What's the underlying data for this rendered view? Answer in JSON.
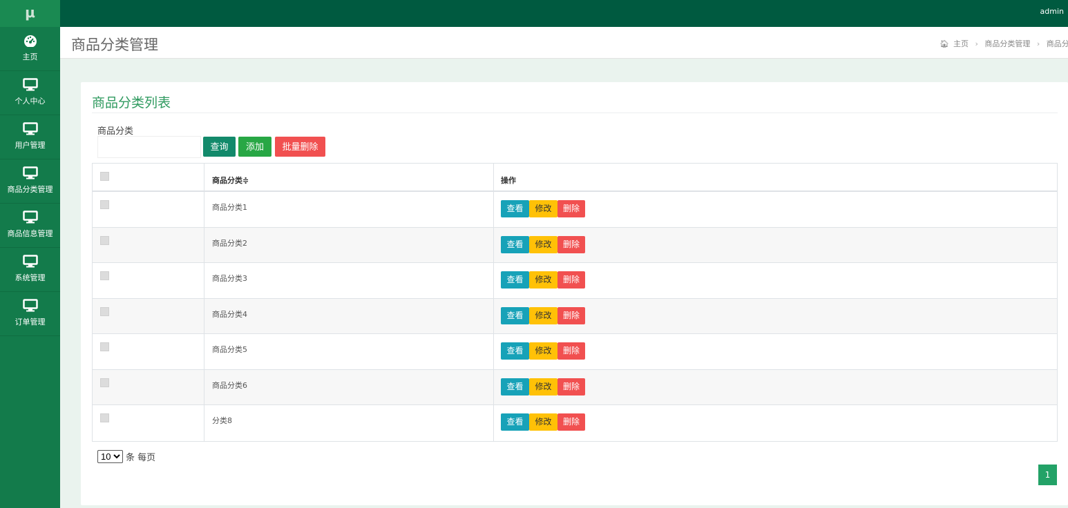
{
  "topbar": {
    "logo": "μ",
    "user": "admin"
  },
  "sidebar": {
    "items": [
      {
        "label": "主页",
        "icon": "dashboard-icon"
      },
      {
        "label": "个人中心",
        "icon": "monitor-icon"
      },
      {
        "label": "用户管理",
        "icon": "monitor-icon"
      },
      {
        "label": "商品分类管理",
        "icon": "monitor-icon"
      },
      {
        "label": "商品信息管理",
        "icon": "monitor-icon"
      },
      {
        "label": "系统管理",
        "icon": "monitor-icon"
      },
      {
        "label": "订单管理",
        "icon": "monitor-icon"
      }
    ]
  },
  "header": {
    "title": "商品分类管理",
    "breadcrumb": {
      "home_icon": "home-icon",
      "home": "主页",
      "level2": "商品分类管理",
      "level3": "商品分"
    }
  },
  "panel": {
    "title": "商品分类列表",
    "filter_label": "商品分类",
    "filter_value": "",
    "buttons": {
      "query": "查询",
      "add": "添加",
      "batch_delete": "批量删除"
    }
  },
  "table": {
    "columns": {
      "name": "商品分类",
      "sort_indicator": "≑",
      "ops": "操作"
    },
    "rows": [
      "商品分类1",
      "商品分类2",
      "商品分类3",
      "商品分类4",
      "商品分类5",
      "商品分类6",
      "分类8"
    ],
    "row_actions": {
      "view": "查看",
      "edit": "修改",
      "delete": "删除"
    }
  },
  "pager": {
    "page_size": "10",
    "page_size_suffix": "条 每页",
    "current_page": "1"
  },
  "colors": {
    "topbar": "#005a40",
    "sidebar": "#137b4b",
    "accent": "#2f9a5f",
    "danger": "#f15050",
    "info": "#17a2b8",
    "warning": "#ffc107"
  }
}
